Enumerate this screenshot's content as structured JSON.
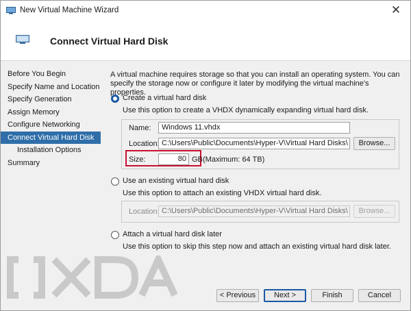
{
  "window": {
    "title": "New Virtual Machine Wizard",
    "close_glyph": "✕"
  },
  "header": {
    "title": "Connect Virtual Hard Disk"
  },
  "nav": {
    "items": [
      {
        "label": "Before You Begin"
      },
      {
        "label": "Specify Name and Location"
      },
      {
        "label": "Specify Generation"
      },
      {
        "label": "Assign Memory"
      },
      {
        "label": "Configure Networking"
      },
      {
        "label": "Connect Virtual Hard Disk",
        "selected": true
      },
      {
        "label": "Installation Options",
        "sub": true
      },
      {
        "label": "Summary"
      }
    ]
  },
  "content": {
    "intro": "A virtual machine requires storage so that you can install an operating system. You can specify the storage now or configure it later by modifying the virtual machine's properties.",
    "create": {
      "label": "Create a virtual hard disk",
      "desc": "Use this option to create a VHDX dynamically expanding virtual hard disk.",
      "name_label": "Name:",
      "name_value": "Windows 11.vhdx",
      "location_label": "Location:",
      "location_value": "C:\\Users\\Public\\Documents\\Hyper-V\\Virtual Hard Disks\\",
      "browse_label": "Browse...",
      "size_label": "Size:",
      "size_value": "80",
      "size_unit": "GB",
      "size_max": "(Maximum: 64 TB)"
    },
    "existing": {
      "label": "Use an existing virtual hard disk",
      "desc": "Use this option to attach an existing VHDX virtual hard disk.",
      "location_label": "Location:",
      "location_value": "C:\\Users\\Public\\Documents\\Hyper-V\\Virtual Hard Disks\\",
      "browse_label": "Browse..."
    },
    "later": {
      "label": "Attach a virtual hard disk later",
      "desc": "Use this option to skip this step now and attach an existing virtual hard disk later."
    }
  },
  "footer": {
    "previous_label": "< Previous",
    "next_label": "Next >",
    "finish_label": "Finish",
    "cancel_label": "Cancel"
  },
  "watermark": {
    "text": "XDA"
  },
  "colors": {
    "selected_nav": "#2f6ea8",
    "highlight_box": "#c8102e",
    "accent": "#1a5aa6"
  }
}
